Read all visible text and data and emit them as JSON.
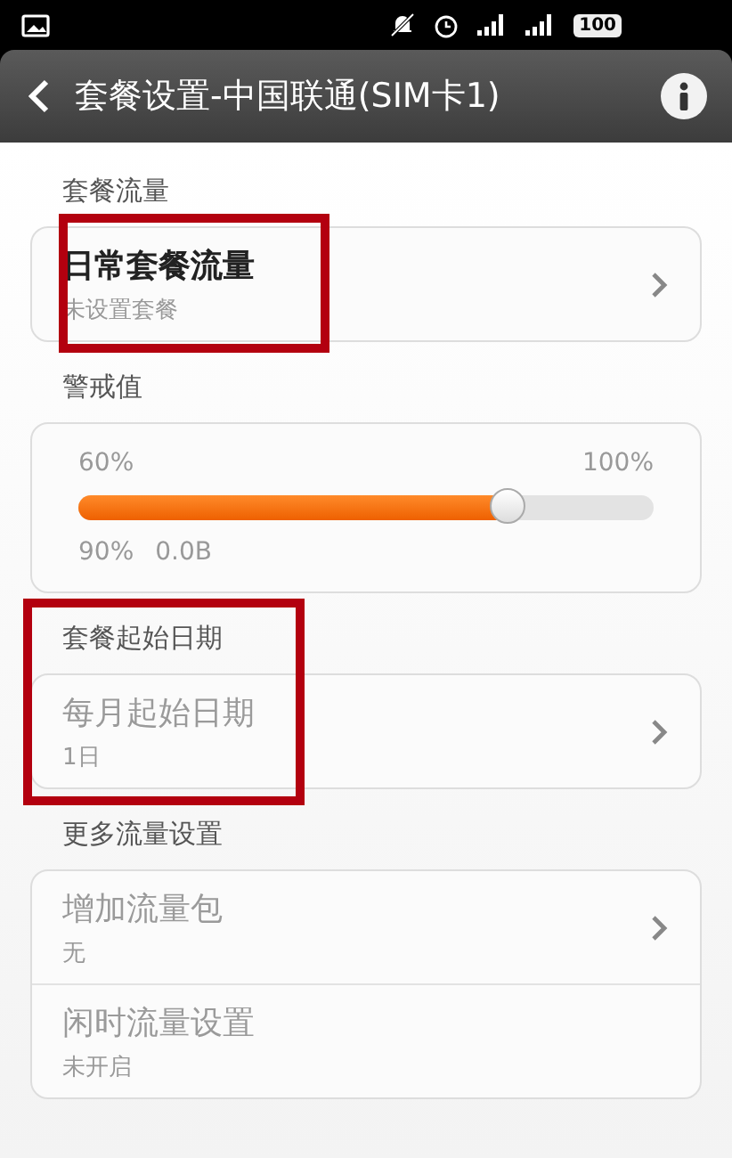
{
  "status_bar": {
    "battery": "100"
  },
  "header": {
    "title": "套餐设置-中国联通(SIM卡1)"
  },
  "sections": [
    {
      "label": "套餐流量",
      "annotated": false,
      "kind": "list",
      "items": [
        {
          "title": "日常套餐流量",
          "subtitle": "未设置套餐",
          "dimmed": false,
          "chevron": true,
          "annotated": true
        }
      ]
    },
    {
      "label": "警戒值",
      "annotated": false,
      "kind": "slider",
      "min_label": "60%",
      "max_label": "100%",
      "level": 0.745,
      "value": "90%",
      "amount": "0.0B"
    },
    {
      "label": "套餐起始日期",
      "annotated": true,
      "kind": "list",
      "items": [
        {
          "title": "每月起始日期",
          "subtitle": "1日",
          "dimmed": true,
          "chevron": true,
          "annotated": false
        }
      ]
    },
    {
      "label": "更多流量设置",
      "annotated": false,
      "kind": "list",
      "items": [
        {
          "title": "增加流量包",
          "subtitle": "无",
          "dimmed": true,
          "chevron": true,
          "annotated": false
        },
        {
          "title": "闲时流量设置",
          "subtitle": "未开启",
          "dimmed": true,
          "chevron": false,
          "annotated": false
        }
      ]
    }
  ]
}
